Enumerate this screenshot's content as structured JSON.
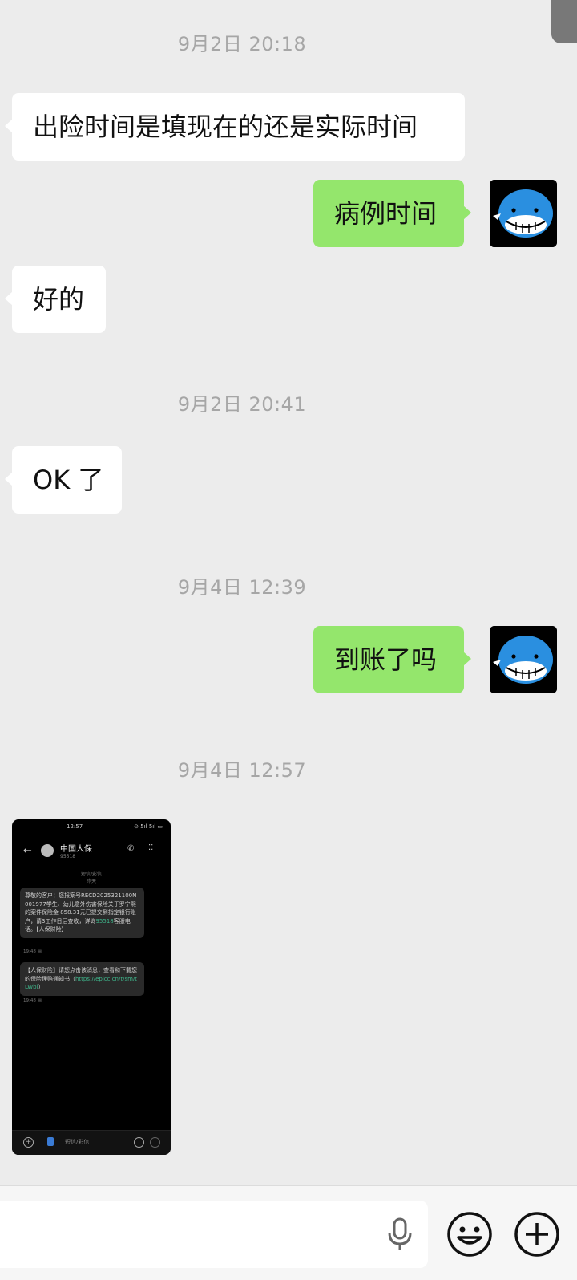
{
  "messages": [
    {
      "type": "timestamp",
      "text": "9月2日 20:18"
    },
    {
      "type": "incoming",
      "text": "出险时间是填现在的还是实际时间"
    },
    {
      "type": "outgoing",
      "text": "病例时间"
    },
    {
      "type": "incoming",
      "text": "好的"
    },
    {
      "type": "timestamp",
      "text": "9月2日 20:41"
    },
    {
      "type": "incoming",
      "text": "OK 了"
    },
    {
      "type": "timestamp",
      "text": "9月4日 12:39"
    },
    {
      "type": "outgoing",
      "text": "到账了吗"
    },
    {
      "type": "timestamp",
      "text": "9月4日 12:57"
    }
  ],
  "screenshot": {
    "status_time": "12:57",
    "status_right": "⊙ 5ıl 5ıl ▭",
    "contact_name": "中国人保",
    "contact_number": "95518",
    "section_label": "短信/彩信",
    "day_label": "昨天",
    "sms1_text": "尊敬的客户：您报案号RECD2025321100N001977学生、幼儿意外伤害保险关于罗宁熙的案件保险金 858.31元已提交到指定银行账户，请3工作日后查收，详询",
    "sms1_link": "95518",
    "sms1_tail": "客服电话。【人保财险】",
    "sms1_meta": "19:48 ▤",
    "sms2_text": "【人保财险】请您点击该消息，查看和下载您的保险理赔通知书（",
    "sms2_link": "https://epicc.cn/t/sm/tLWbl",
    "sms2_tail": "）",
    "sms2_meta": "19:48 ▤",
    "input_placeholder": "短信/彩信"
  },
  "input_bar": {
    "voice_icon": "microphone-icon",
    "emoji_icon": "emoji-icon",
    "more_icon": "plus-icon"
  },
  "avatar_icon": "blue-whale-icon"
}
